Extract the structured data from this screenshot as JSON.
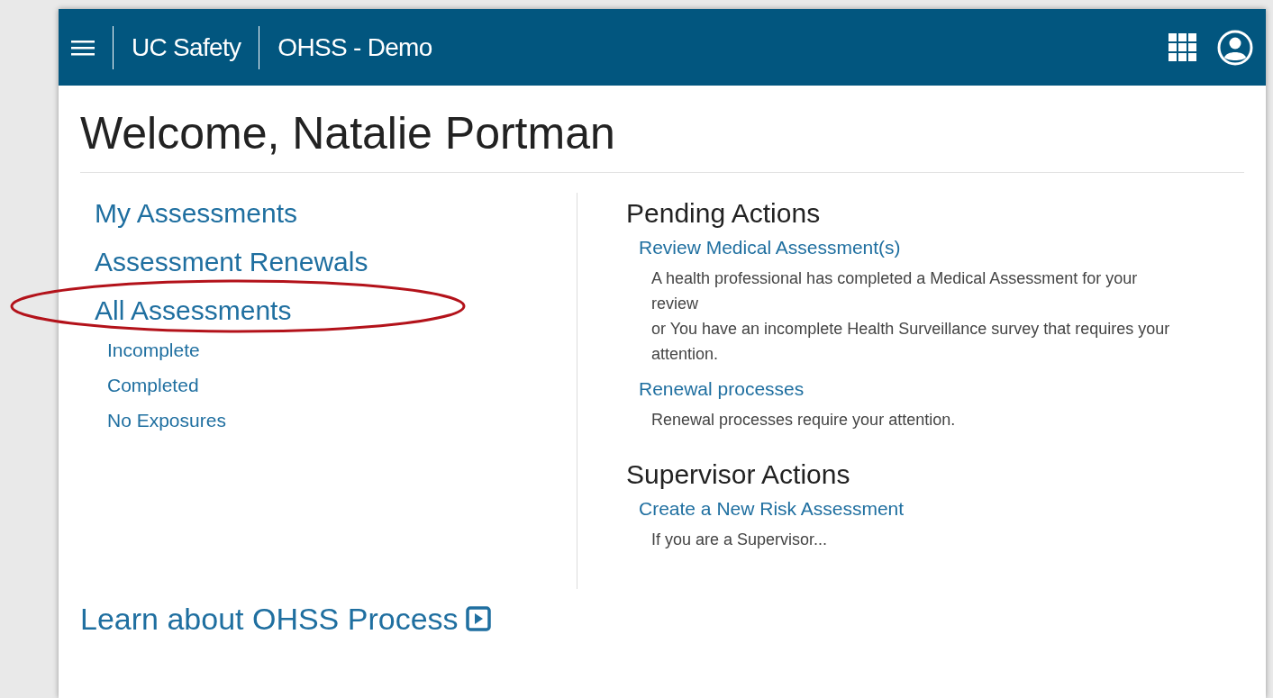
{
  "header": {
    "brand": "UC Safety",
    "app_name": "OHSS - Demo"
  },
  "welcome": "Welcome, Natalie Portman",
  "left_links": [
    {
      "label": "My Assessments",
      "highlighted": false
    },
    {
      "label": "Assessment Renewals",
      "highlighted": false
    },
    {
      "label": "All Assessments",
      "highlighted": true,
      "children": [
        {
          "label": "Incomplete"
        },
        {
          "label": "Completed"
        },
        {
          "label": "No Exposures"
        }
      ]
    }
  ],
  "sections": [
    {
      "title": "Pending Actions",
      "items": [
        {
          "link": "Review Medical Assessment(s)",
          "lines": [
            "A health professional has completed a Medical Assessment for your review",
            "or You have an incomplete Health Surveillance survey that requires your attention."
          ]
        },
        {
          "link": "Renewal processes",
          "lines": [
            "Renewal processes require your attention."
          ]
        }
      ]
    },
    {
      "title": "Supervisor Actions",
      "items": [
        {
          "link": "Create a New Risk Assessment",
          "lines": [
            "If you are a Supervisor..."
          ]
        }
      ]
    }
  ],
  "learn_link": "Learn about OHSS Process"
}
